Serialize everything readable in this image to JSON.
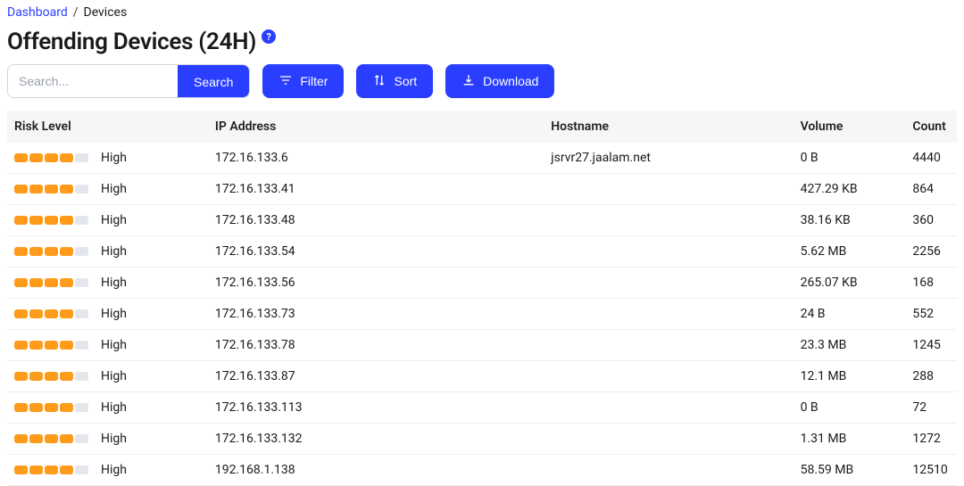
{
  "breadcrumb": {
    "dashboard": "Dashboard",
    "sep": "/",
    "current": "Devices"
  },
  "title": "Offending Devices (24H)",
  "help_glyph": "?",
  "controls": {
    "search_placeholder": "Search...",
    "search_btn": "Search",
    "filter_btn": "Filter",
    "sort_btn": "Sort",
    "download_btn": "Download"
  },
  "headers": {
    "risk": "Risk Level",
    "ip": "IP Address",
    "host": "Hostname",
    "volume": "Volume",
    "count": "Count"
  },
  "rows": [
    {
      "risk_label": "High",
      "risk_bars": 4,
      "ip": "172.16.133.6",
      "host": "jsrvr27.jaalam.net",
      "volume": "0 B",
      "count": "4440"
    },
    {
      "risk_label": "High",
      "risk_bars": 4,
      "ip": "172.16.133.41",
      "host": "",
      "volume": "427.29 KB",
      "count": "864"
    },
    {
      "risk_label": "High",
      "risk_bars": 4,
      "ip": "172.16.133.48",
      "host": "",
      "volume": "38.16 KB",
      "count": "360"
    },
    {
      "risk_label": "High",
      "risk_bars": 4,
      "ip": "172.16.133.54",
      "host": "",
      "volume": "5.62 MB",
      "count": "2256"
    },
    {
      "risk_label": "High",
      "risk_bars": 4,
      "ip": "172.16.133.56",
      "host": "",
      "volume": "265.07 KB",
      "count": "168"
    },
    {
      "risk_label": "High",
      "risk_bars": 4,
      "ip": "172.16.133.73",
      "host": "",
      "volume": "24 B",
      "count": "552"
    },
    {
      "risk_label": "High",
      "risk_bars": 4,
      "ip": "172.16.133.78",
      "host": "",
      "volume": "23.3 MB",
      "count": "1245"
    },
    {
      "risk_label": "High",
      "risk_bars": 4,
      "ip": "172.16.133.87",
      "host": "",
      "volume": "12.1 MB",
      "count": "288"
    },
    {
      "risk_label": "High",
      "risk_bars": 4,
      "ip": "172.16.133.113",
      "host": "",
      "volume": "0 B",
      "count": "72"
    },
    {
      "risk_label": "High",
      "risk_bars": 4,
      "ip": "172.16.133.132",
      "host": "",
      "volume": "1.31 MB",
      "count": "1272"
    },
    {
      "risk_label": "High",
      "risk_bars": 4,
      "ip": "192.168.1.138",
      "host": "",
      "volume": "58.59 MB",
      "count": "12510"
    }
  ]
}
